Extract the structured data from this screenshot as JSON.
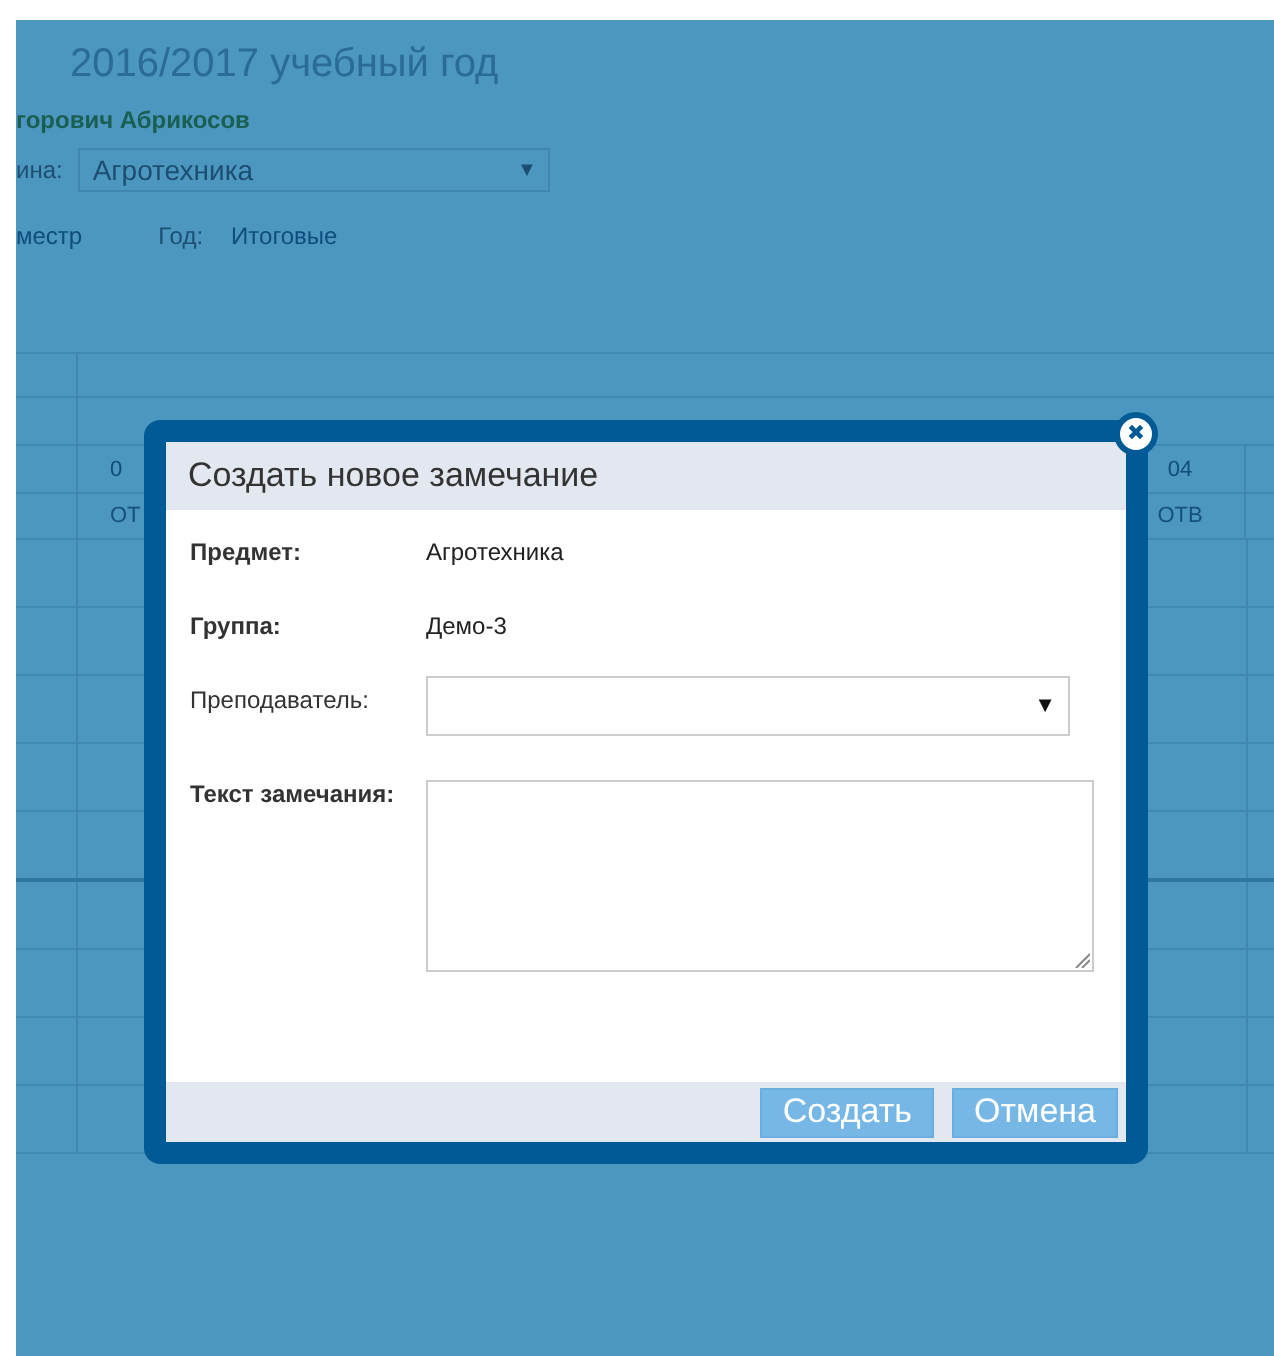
{
  "page": {
    "title": "2016/2017 учебный год",
    "user_name": "горович Абрикосов",
    "subject_label": "ина:",
    "subject_select": "Агротехника",
    "subject_caret": "▼",
    "period_link": "местр",
    "year_label": "Год:",
    "year_link": "Итоговые"
  },
  "table": {
    "header_cells": [
      {
        "number": "0",
        "kind_label": "ОТ"
      },
      {
        "number": "04",
        "kind_label": "ОТВ"
      }
    ]
  },
  "dialog": {
    "title": "Создать новое замечание",
    "close_icon": "✖",
    "fields": [
      {
        "kind": "static",
        "label": "Предмет:",
        "value": "Агротехника"
      },
      {
        "kind": "static",
        "label": "Группа:",
        "value": "Демо-3"
      },
      {
        "kind": "select",
        "label": "Преподаватель:",
        "caret": "▼"
      },
      {
        "kind": "textarea",
        "label": "Текст замечания:"
      }
    ],
    "buttons": [
      "Создать",
      "Отмена"
    ]
  }
}
